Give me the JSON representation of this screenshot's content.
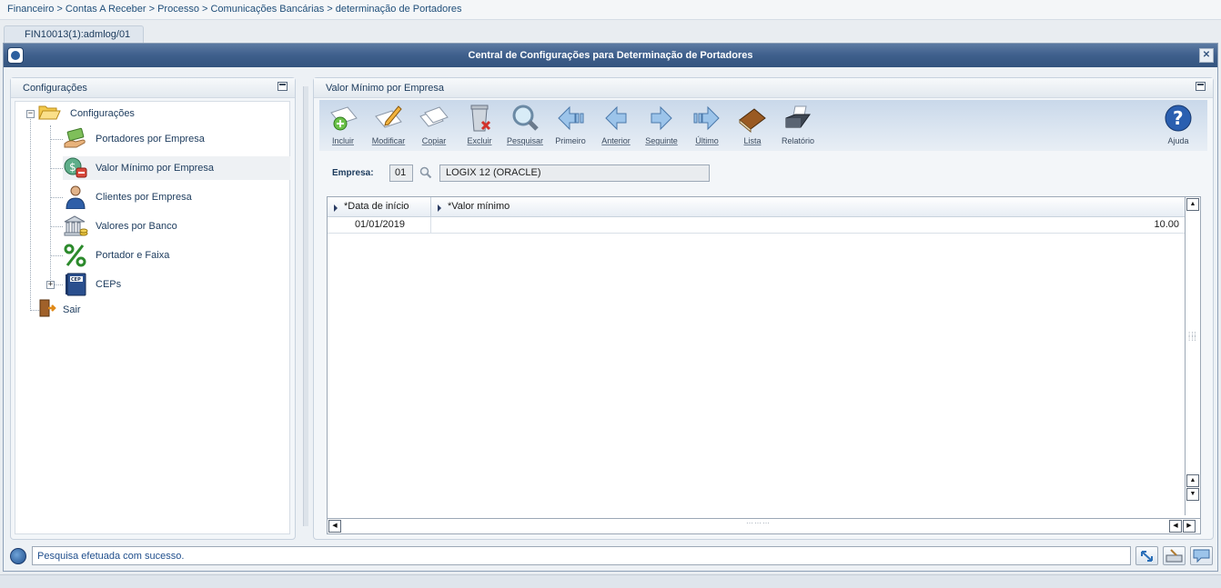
{
  "breadcrumb": "Financeiro > Contas A Receber > Processo > Comunicações Bancárias > determinação de Portadores",
  "tab_label": "FIN10013(1):admlog/01",
  "window_title": "Central de Configurações para Determinação de Portadores",
  "left_panel": {
    "title": "Configurações",
    "tree": {
      "root": "Configurações",
      "items": [
        {
          "label": "Portadores por Empresa",
          "icon": "money-hand-icon"
        },
        {
          "label": "Valor Mínimo por Empresa",
          "icon": "money-minus-icon"
        },
        {
          "label": "Clientes por Empresa",
          "icon": "person-icon"
        },
        {
          "label": "Valores por Banco",
          "icon": "bank-icon"
        },
        {
          "label": "Portador e Faixa",
          "icon": "percent-icon"
        },
        {
          "label": "CEPs",
          "icon": "cep-book-icon"
        }
      ],
      "exit": "Sair"
    }
  },
  "right_panel": {
    "title": "Valor Mínimo por Empresa",
    "toolbar": {
      "incluir": "Incluir",
      "modificar": "Modificar",
      "copiar": "Copiar",
      "excluir": "Excluir",
      "pesquisar": "Pesquisar",
      "primeiro": "Primeiro",
      "anterior": "Anterior",
      "seguinte": "Seguinte",
      "ultimo": "Último",
      "lista": "Lista",
      "relatorio": "Relatório",
      "ajuda": "Ajuda"
    },
    "empresa": {
      "label": "Empresa:",
      "code": "01",
      "name": "LOGIX 12 (ORACLE)"
    },
    "grid": {
      "columns": [
        "*Data de início",
        "*Valor mínimo"
      ],
      "rows": [
        {
          "data_inicio": "01/01/2019",
          "valor_minimo": "10.00"
        }
      ]
    }
  },
  "status_message": "Pesquisa efetuada com sucesso.",
  "colors": {
    "title_bar": "#3e5f8c",
    "text_blue": "#1f4e79",
    "toolbar_bg": "#dce6f1"
  }
}
